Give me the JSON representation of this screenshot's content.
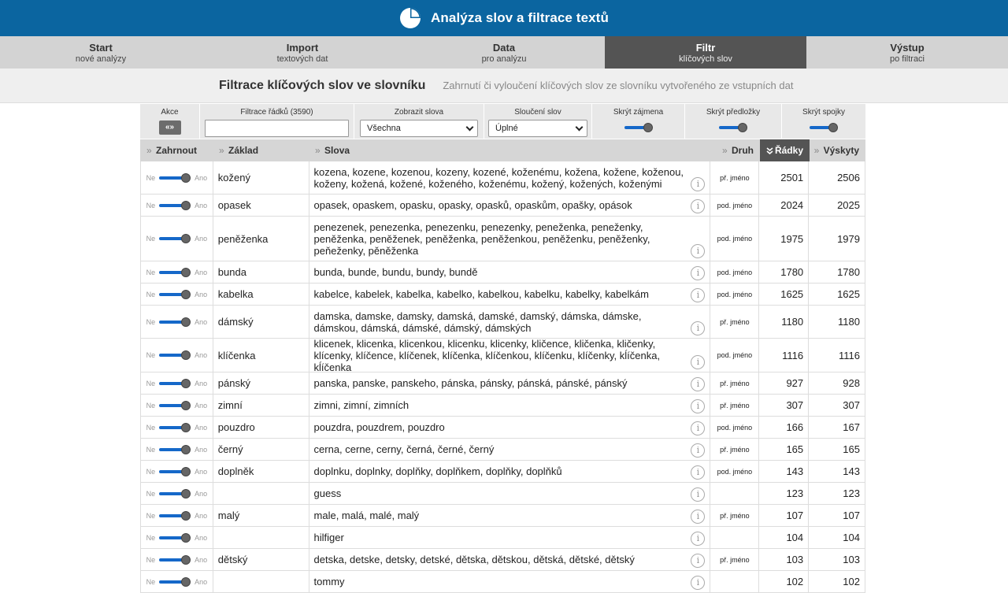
{
  "app": {
    "title": "Analýza slov a filtrace textů",
    "logo_icon": "pie-chart-icon"
  },
  "steps": [
    {
      "title": "Start",
      "sub": "nové analýzy"
    },
    {
      "title": "Import",
      "sub": "textových dat"
    },
    {
      "title": "Data",
      "sub": "pro analýzu"
    },
    {
      "title": "Filtr",
      "sub": "klíčových slov",
      "active": true
    },
    {
      "title": "Výstup",
      "sub": "po filtraci"
    }
  ],
  "page": {
    "title": "Filtrace klíčových slov ve slovníku",
    "subtitle": "Zahrnutí či vyloučení klíčových slov ze slovníku vytvořeného ze vstupních dat"
  },
  "filters": {
    "akce_label": "Akce",
    "akce_button": "«»",
    "row_filter_label": "Filtrace řádků (3590)",
    "row_filter_value": "",
    "show_words_label": "Zobrazit slova",
    "show_words_value": "Všechna",
    "merge_label": "Sloučení slov",
    "merge_value": "Úplné",
    "hide_pronouns_label": "Skrýt zájmena",
    "hide_prepositions_label": "Skrýt předložky",
    "hide_conjunctions_label": "Skrýt spojky"
  },
  "table": {
    "headers": {
      "zahrnout": "Zahrnout",
      "zaklad": "Základ",
      "slova": "Slova",
      "druh": "Druh",
      "radky": "Řádky",
      "vyskyty": "Výskyty"
    },
    "sort_marker": "»",
    "sort_active_icon": "double-chevron-down-icon",
    "toggle_no": "Ne",
    "toggle_yes": "Ano",
    "rows": [
      {
        "zaklad": "kožený",
        "slova": "kozena, kozene, kozenou, kozeny, kozené, koženému, kožena, kožene, koženou, koženy, kožená, kožené, koženého, koženému, kožený, kožených, koženými",
        "druh": "př. jméno",
        "radky": "2501",
        "vyskyty": "2506"
      },
      {
        "zaklad": "opasek",
        "slova": "opasek, opaskem, opasku, opasky, opasků, opaskům, opašky, opások",
        "druh": "pod. jméno",
        "radky": "2024",
        "vyskyty": "2025"
      },
      {
        "zaklad": "peněženka",
        "slova": "penezenek, penezenka, penezenku, penezenky, peneženka, peneženky, peněženka, peněženek, peněženka, peněženkou, peněženku, peněženky, peňeženky, pěněženka",
        "druh": "pod. jméno",
        "radky": "1975",
        "vyskyty": "1979"
      },
      {
        "zaklad": "bunda",
        "slova": "bunda, bunde, bundu, bundy, bundě",
        "druh": "pod. jméno",
        "radky": "1780",
        "vyskyty": "1780"
      },
      {
        "zaklad": "kabelka",
        "slova": "kabelce, kabelek, kabelka, kabelko, kabelkou, kabelku, kabelky, kabelkám",
        "druh": "pod. jméno",
        "radky": "1625",
        "vyskyty": "1625"
      },
      {
        "zaklad": "dámský",
        "slova": "damska, damske, damsky, damská, damské, damský, dámska, dámske, dámskou, dámská, dámské, dámský, dámských",
        "druh": "př. jméno",
        "radky": "1180",
        "vyskyty": "1180"
      },
      {
        "zaklad": "klíčenka",
        "slova": "klicenek, klicenka, klicenkou, klicenku, klicenky, kličence, kličenka, kličenky, klícenky, klíčence, klíčenek, klíčenka, klíčenkou, klíčenku, klíčenky, kĺíčenka, kĺíčenka",
        "druh": "pod. jméno",
        "radky": "1116",
        "vyskyty": "1116"
      },
      {
        "zaklad": "pánský",
        "slova": "panska, panske, panskeho, pánska, pánsky, pánská, pánské, pánský",
        "druh": "př. jméno",
        "radky": "927",
        "vyskyty": "928"
      },
      {
        "zaklad": "zimní",
        "slova": "zimni, zimní, zimních",
        "druh": "př. jméno",
        "radky": "307",
        "vyskyty": "307"
      },
      {
        "zaklad": "pouzdro",
        "slova": "pouzdra, pouzdrem, pouzdro",
        "druh": "pod. jméno",
        "radky": "166",
        "vyskyty": "167"
      },
      {
        "zaklad": "černý",
        "slova": "cerna, cerne, cerny, černá, černé, černý",
        "druh": "př. jméno",
        "radky": "165",
        "vyskyty": "165"
      },
      {
        "zaklad": "doplněk",
        "slova": "doplnku, doplnky, doplňky, doplňkem, doplňky, doplňků",
        "druh": "pod. jméno",
        "radky": "143",
        "vyskyty": "143"
      },
      {
        "zaklad": "",
        "slova": "guess",
        "druh": "",
        "radky": "123",
        "vyskyty": "123"
      },
      {
        "zaklad": "malý",
        "slova": "male, malá, malé, malý",
        "druh": "př. jméno",
        "radky": "107",
        "vyskyty": "107"
      },
      {
        "zaklad": "",
        "slova": "hilfiger",
        "druh": "",
        "radky": "104",
        "vyskyty": "104"
      },
      {
        "zaklad": "dětský",
        "slova": "detska, detske, detsky, detské, dětska, dětskou, dětská, dětské, dětský",
        "druh": "př. jméno",
        "radky": "103",
        "vyskyty": "103"
      },
      {
        "zaklad": "",
        "slova": "tommy",
        "druh": "",
        "radky": "102",
        "vyskyty": "102"
      }
    ]
  }
}
